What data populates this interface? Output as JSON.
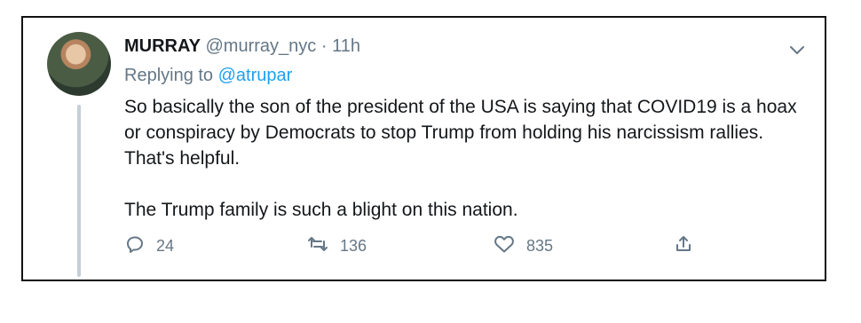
{
  "tweet": {
    "author_name": "MURRAY",
    "author_handle": "@murray_nyc",
    "separator": "·",
    "timestamp": "11h",
    "reply_prefix": "Replying to",
    "reply_handle": "@atrupar",
    "body_paragraphs": [
      "So basically the son of the president of the USA is saying that COVID19 is a hoax or conspiracy by Democrats to stop Trump from holding his narcissism rallies. That's helpful.",
      "The Trump family is such a blight on this nation."
    ],
    "actions": {
      "reply_count": "24",
      "retweet_count": "136",
      "like_count": "835"
    },
    "icons": [
      "chevron-down-icon",
      "reply-icon",
      "retweet-icon",
      "like-icon",
      "share-icon"
    ],
    "colors": {
      "text": "#14171a",
      "muted": "#657786",
      "link": "#1da1f2",
      "thread_line": "#c4cfd6"
    }
  }
}
